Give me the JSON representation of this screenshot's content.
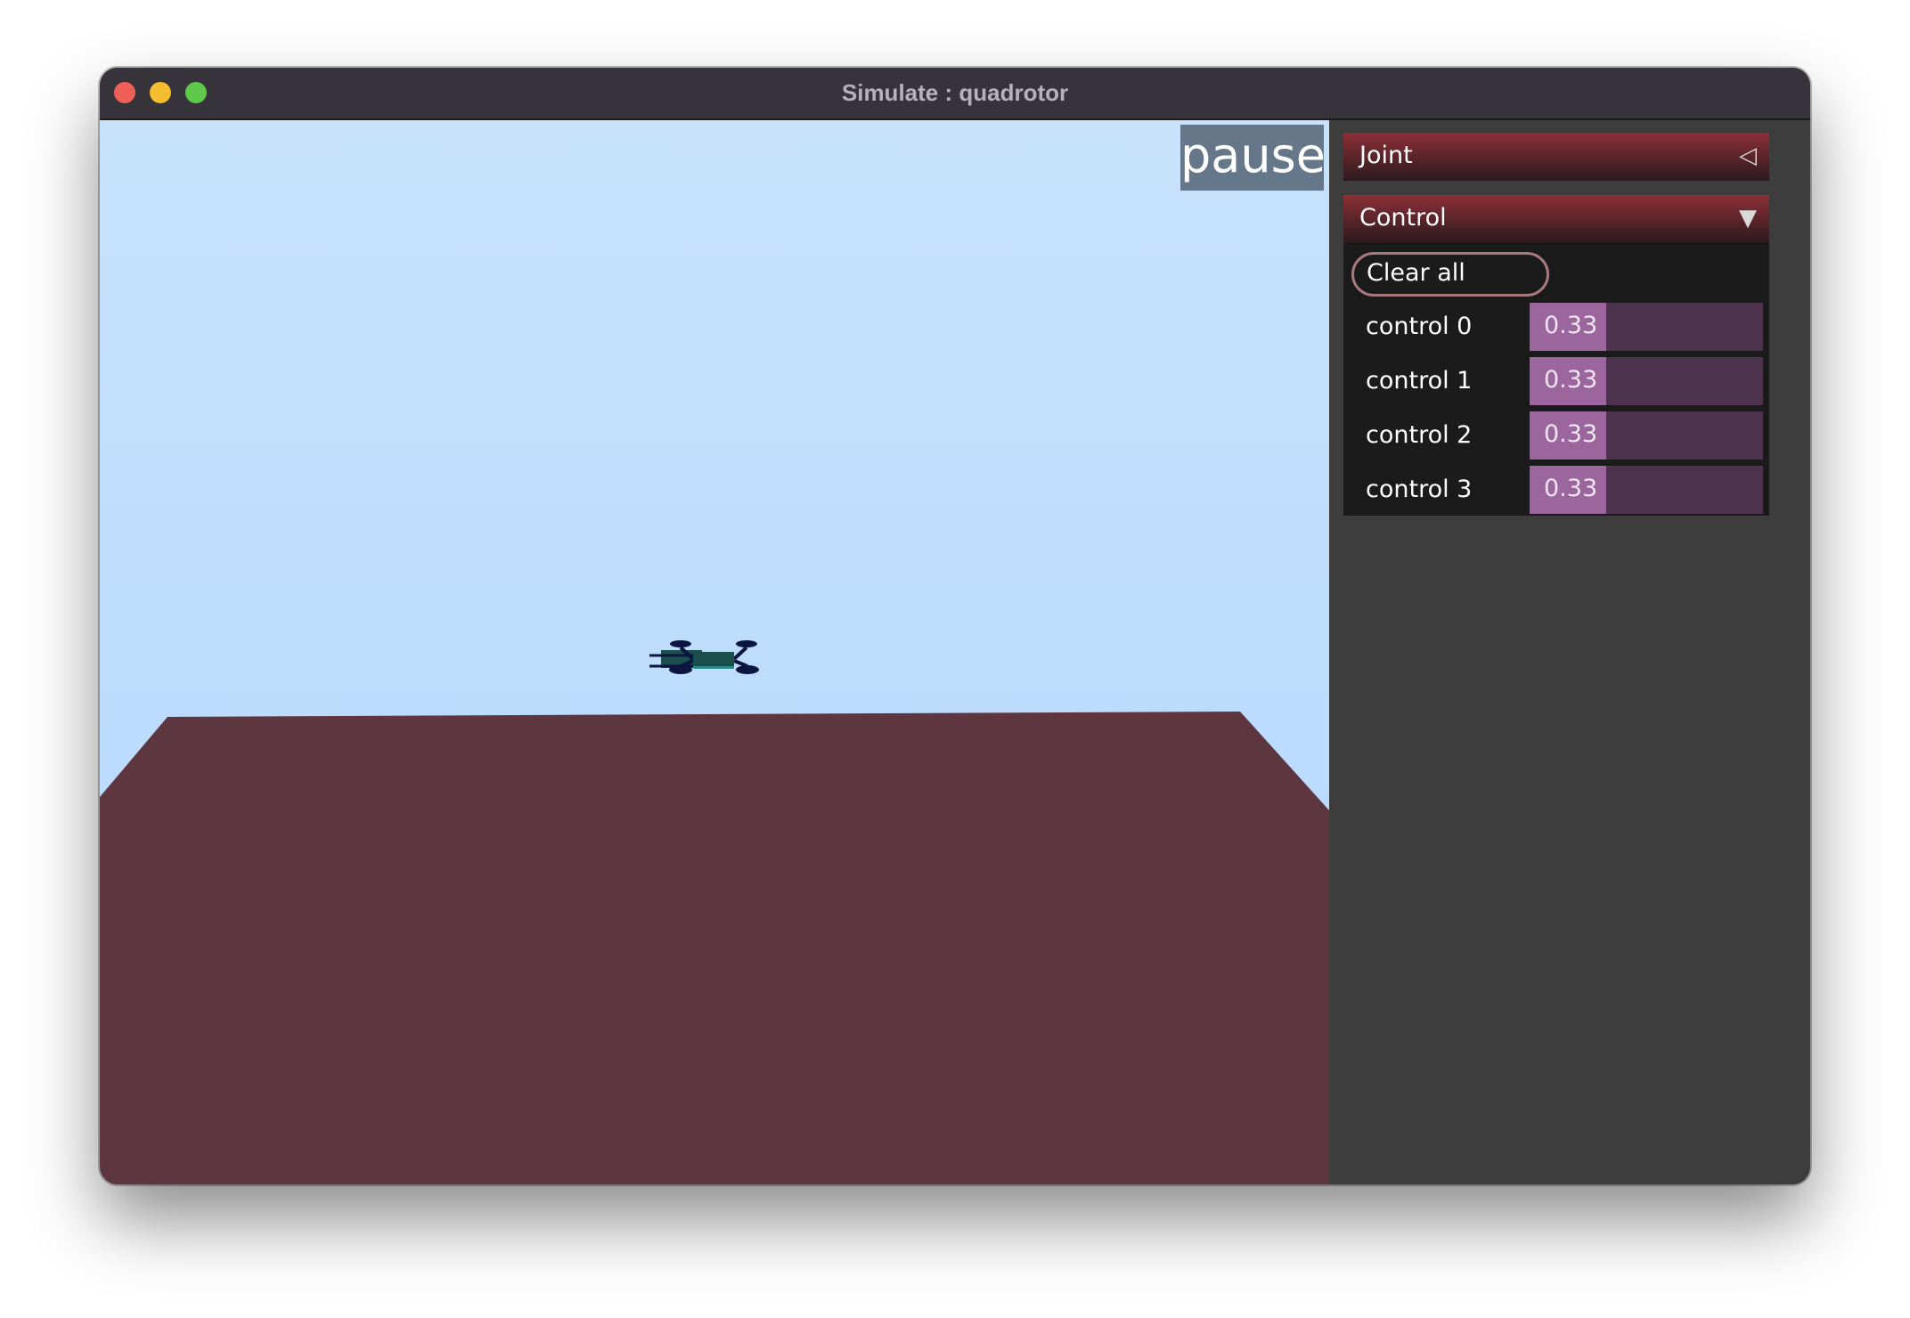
{
  "window": {
    "title": "Simulate : quadrotor"
  },
  "viewport": {
    "pause_label": "pause",
    "sky_color": "#c8e2fb",
    "floor_color": "#5e3640",
    "drone_color": "#1b4f4d"
  },
  "panel": {
    "joint": {
      "label": "Joint",
      "arrow": "◁",
      "icon": "collapsed-triangle-icon"
    },
    "control": {
      "label": "Control",
      "arrow": "▼",
      "icon": "expanded-triangle-icon",
      "clear_all_label": "Clear all",
      "controls": [
        {
          "label": "control 0",
          "value": "0.33",
          "fraction": 0.33
        },
        {
          "label": "control 1",
          "value": "0.33",
          "fraction": 0.33
        },
        {
          "label": "control 2",
          "value": "0.33",
          "fraction": 0.33
        },
        {
          "label": "control 3",
          "value": "0.33",
          "fraction": 0.33
        }
      ]
    },
    "accent_color": "#9a669d"
  }
}
